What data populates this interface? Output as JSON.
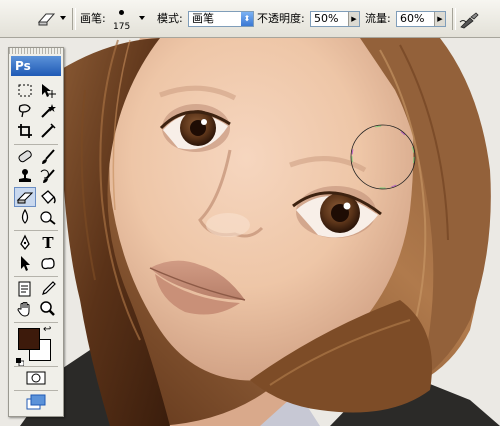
{
  "options_bar": {
    "brush_label": "画笔:",
    "brush_size": "175",
    "mode_label": "模式:",
    "mode_value": "画笔",
    "opacity_label": "不透明度:",
    "opacity_value": "50%",
    "flow_label": "流量:",
    "flow_value": "60%"
  },
  "toolbox": {
    "logo": "Ps",
    "text_tool_glyph": "T",
    "foreground_color": "#3d1a0b",
    "background_color": "#ffffff"
  },
  "tools": [
    "marquee",
    "move",
    "lasso",
    "magic-wand",
    "crop",
    "slice",
    "healing-brush",
    "brush",
    "clone-stamp",
    "history-brush",
    "eraser",
    "paint-bucket",
    "blur",
    "dodge",
    "pen",
    "type",
    "path-selection",
    "custom-shape",
    "notes",
    "eyedropper",
    "hand",
    "zoom"
  ]
}
